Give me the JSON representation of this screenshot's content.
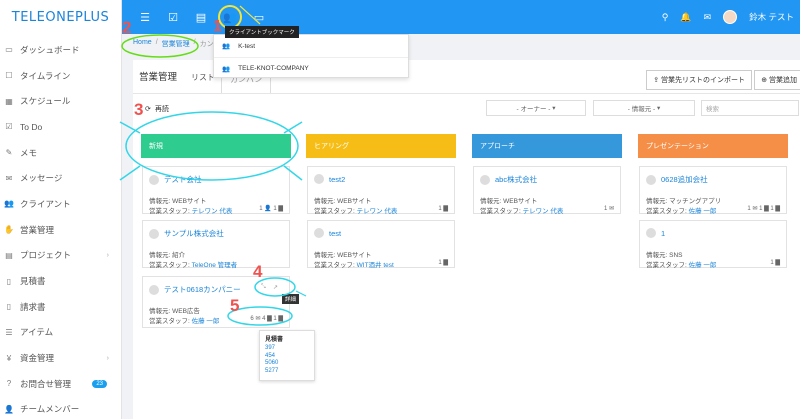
{
  "sidebar": {
    "logo": "TELEONEPLUS",
    "items": [
      {
        "label": "ダッシュボード",
        "icon": "monitor-icon"
      },
      {
        "label": "タイムライン",
        "icon": "square-icon"
      },
      {
        "label": "スケジュール",
        "icon": "calendar-icon"
      },
      {
        "label": "To Do",
        "icon": "check-icon"
      },
      {
        "label": "メモ",
        "icon": "pencil-icon"
      },
      {
        "label": "メッセージ",
        "icon": "mail-icon"
      },
      {
        "label": "クライアント",
        "icon": "users-icon"
      },
      {
        "label": "営業管理",
        "icon": "handshake-icon"
      },
      {
        "label": "プロジェクト",
        "icon": "briefcase-icon"
      },
      {
        "label": "見積書",
        "icon": "file-icon"
      },
      {
        "label": "請求書",
        "icon": "file-icon"
      },
      {
        "label": "アイテム",
        "icon": "list-icon"
      },
      {
        "label": "資金管理",
        "icon": "yen-icon"
      },
      {
        "label": "お問合せ管理",
        "icon": "question-icon",
        "badge": "23"
      },
      {
        "label": "チームメンバー",
        "icon": "user-icon"
      }
    ]
  },
  "topbar": {
    "user_name": "鈴木 テスト",
    "bookmark_tooltip": "クライアントブックマーク"
  },
  "bookmark_dropdown": {
    "items": [
      "K-test",
      "TELE-KNOT-COMPANY"
    ]
  },
  "breadcrumb": {
    "home": "Home",
    "section": "営業管理",
    "current": "カン"
  },
  "panel": {
    "title": "営業管理",
    "tab_list": "リスト",
    "tab_kanban": "カンバン",
    "import_btn": "営業先リストのインポート",
    "add_btn": "営業追加"
  },
  "filters": {
    "refresh": "再読",
    "owner": "- オーナー -",
    "source": "- 情報元 -",
    "search_placeholder": "検索"
  },
  "columns": [
    {
      "name": "新規",
      "color": "#2ecc8f"
    },
    {
      "name": "ヒアリング",
      "color": "#f6bd16"
    },
    {
      "name": "アプローチ",
      "color": "#3498db"
    },
    {
      "name": "プレゼンテーション",
      "color": "#f58f48"
    }
  ],
  "cards": {
    "c1": {
      "name": "テスト会社",
      "source": "情報元: WEBサイト",
      "staff_label": "営業スタッフ:",
      "staff": "テレワン 代表",
      "counts": "1 👤 1 ▇"
    },
    "c2": {
      "name": "サンプル株式会社",
      "source": "情報元: 紹介",
      "staff_label": "営業スタッフ:",
      "staff": "TeleOne 管理者",
      "counts": ""
    },
    "c3": {
      "name": "テスト0618カンパニー",
      "source": "情報元: WEB広告",
      "staff_label": "営業スタッフ:",
      "staff": "佐藤 一郎",
      "counts": "6 ✉ 4 ▇ 1 ▇"
    },
    "c4": {
      "name": "test2",
      "source": "情報元: WEBサイト",
      "staff_label": "営業スタッフ:",
      "staff": "テレワン 代表",
      "counts": "1 ▇"
    },
    "c5": {
      "name": "test",
      "source": "情報元: WEBサイト",
      "staff_label": "営業スタッフ:",
      "staff": "WIT酒井 test",
      "counts": "1 ▇"
    },
    "c6": {
      "name": "abc株式会社",
      "source": "情報元: WEBサイト",
      "staff_label": "営業スタッフ:",
      "staff": "テレワン 代表",
      "counts": "1 ✉"
    },
    "c7": {
      "name": "0628追加会社",
      "source": "情報元: マッチングアプリ",
      "staff_label": "営業スタッフ:",
      "staff": "佐藤 一郎",
      "counts": "1 ✉ 1 ▇ 1 ▇"
    },
    "c8": {
      "name": "1",
      "source": "情報元: SNS",
      "staff_label": "営業スタッフ:",
      "staff": "佐藤 一郎",
      "counts": "1 ▇"
    }
  },
  "detail_tip": "詳細",
  "estimates_popup": {
    "title": "見積書",
    "numbers": [
      "397",
      "454",
      "5060",
      "5277"
    ]
  },
  "annotations": [
    "1",
    "2",
    "3",
    "4",
    "5"
  ]
}
